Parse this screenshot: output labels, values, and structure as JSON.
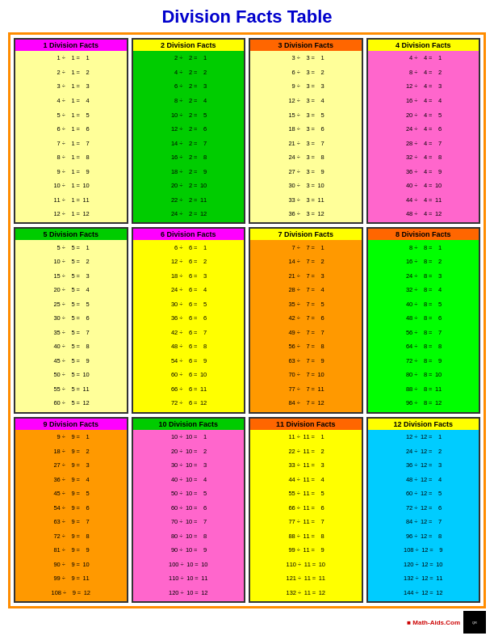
{
  "title": "Division Facts Table",
  "footer": {
    "site": "Math-Aids.Com"
  },
  "sections": [
    {
      "id": "s1",
      "title": "1 Division Facts",
      "divisor": 1,
      "facts": [
        [
          1,
          1,
          1
        ],
        [
          2,
          1,
          2
        ],
        [
          3,
          1,
          3
        ],
        [
          4,
          1,
          4
        ],
        [
          5,
          1,
          5
        ],
        [
          6,
          1,
          6
        ],
        [
          7,
          1,
          7
        ],
        [
          8,
          1,
          8
        ],
        [
          9,
          1,
          9
        ],
        [
          10,
          1,
          10
        ],
        [
          11,
          1,
          11
        ],
        [
          12,
          1,
          12
        ]
      ]
    },
    {
      "id": "s2",
      "title": "2 Division Facts",
      "divisor": 2,
      "facts": [
        [
          2,
          2,
          1
        ],
        [
          4,
          2,
          2
        ],
        [
          6,
          2,
          3
        ],
        [
          8,
          2,
          4
        ],
        [
          10,
          2,
          5
        ],
        [
          12,
          2,
          6
        ],
        [
          14,
          2,
          7
        ],
        [
          16,
          2,
          8
        ],
        [
          18,
          2,
          9
        ],
        [
          20,
          2,
          10
        ],
        [
          22,
          2,
          11
        ],
        [
          24,
          2,
          12
        ]
      ]
    },
    {
      "id": "s3",
      "title": "3 Division Facts",
      "divisor": 3,
      "facts": [
        [
          3,
          3,
          1
        ],
        [
          6,
          3,
          2
        ],
        [
          9,
          3,
          3
        ],
        [
          12,
          3,
          4
        ],
        [
          15,
          3,
          5
        ],
        [
          18,
          3,
          6
        ],
        [
          21,
          3,
          7
        ],
        [
          24,
          3,
          8
        ],
        [
          27,
          3,
          9
        ],
        [
          30,
          3,
          10
        ],
        [
          33,
          3,
          11
        ],
        [
          36,
          3,
          12
        ]
      ]
    },
    {
      "id": "s4",
      "title": "4 Division Facts",
      "divisor": 4,
      "facts": [
        [
          4,
          4,
          1
        ],
        [
          8,
          4,
          2
        ],
        [
          12,
          4,
          3
        ],
        [
          16,
          4,
          4
        ],
        [
          20,
          4,
          5
        ],
        [
          24,
          4,
          6
        ],
        [
          28,
          4,
          7
        ],
        [
          32,
          4,
          8
        ],
        [
          36,
          4,
          9
        ],
        [
          40,
          4,
          10
        ],
        [
          44,
          4,
          11
        ],
        [
          48,
          4,
          12
        ]
      ]
    },
    {
      "id": "s5",
      "title": "5 Division Facts",
      "divisor": 5,
      "facts": [
        [
          5,
          5,
          1
        ],
        [
          10,
          5,
          2
        ],
        [
          15,
          5,
          3
        ],
        [
          20,
          5,
          4
        ],
        [
          25,
          5,
          5
        ],
        [
          30,
          5,
          6
        ],
        [
          35,
          5,
          7
        ],
        [
          40,
          5,
          8
        ],
        [
          45,
          5,
          9
        ],
        [
          50,
          5,
          10
        ],
        [
          55,
          5,
          11
        ],
        [
          60,
          5,
          12
        ]
      ]
    },
    {
      "id": "s6",
      "title": "6 Division Facts",
      "divisor": 6,
      "facts": [
        [
          6,
          6,
          1
        ],
        [
          12,
          6,
          2
        ],
        [
          18,
          6,
          3
        ],
        [
          24,
          6,
          4
        ],
        [
          30,
          6,
          5
        ],
        [
          36,
          6,
          6
        ],
        [
          42,
          6,
          7
        ],
        [
          48,
          6,
          8
        ],
        [
          54,
          6,
          9
        ],
        [
          60,
          6,
          10
        ],
        [
          66,
          6,
          11
        ],
        [
          72,
          6,
          12
        ]
      ]
    },
    {
      "id": "s7",
      "title": "7 Division Facts",
      "divisor": 7,
      "facts": [
        [
          7,
          7,
          1
        ],
        [
          14,
          7,
          2
        ],
        [
          21,
          7,
          3
        ],
        [
          28,
          7,
          4
        ],
        [
          35,
          7,
          5
        ],
        [
          42,
          7,
          6
        ],
        [
          49,
          7,
          7
        ],
        [
          56,
          7,
          8
        ],
        [
          63,
          7,
          9
        ],
        [
          70,
          7,
          10
        ],
        [
          77,
          7,
          11
        ],
        [
          84,
          7,
          12
        ]
      ]
    },
    {
      "id": "s8",
      "title": "8 Division Facts",
      "divisor": 8,
      "facts": [
        [
          8,
          8,
          1
        ],
        [
          16,
          8,
          2
        ],
        [
          24,
          8,
          3
        ],
        [
          32,
          8,
          4
        ],
        [
          40,
          8,
          5
        ],
        [
          48,
          8,
          6
        ],
        [
          56,
          8,
          7
        ],
        [
          64,
          8,
          8
        ],
        [
          72,
          8,
          9
        ],
        [
          80,
          8,
          10
        ],
        [
          88,
          8,
          11
        ],
        [
          96,
          8,
          12
        ]
      ]
    },
    {
      "id": "s9",
      "title": "9 Division Facts",
      "divisor": 9,
      "facts": [
        [
          9,
          9,
          1
        ],
        [
          18,
          9,
          2
        ],
        [
          27,
          9,
          3
        ],
        [
          36,
          9,
          4
        ],
        [
          45,
          9,
          5
        ],
        [
          54,
          9,
          6
        ],
        [
          63,
          9,
          7
        ],
        [
          72,
          9,
          8
        ],
        [
          81,
          9,
          9
        ],
        [
          90,
          9,
          10
        ],
        [
          99,
          9,
          11
        ],
        [
          108,
          9,
          12
        ]
      ]
    },
    {
      "id": "s10",
      "title": "10 Division Facts",
      "divisor": 10,
      "facts": [
        [
          10,
          10,
          1
        ],
        [
          20,
          10,
          2
        ],
        [
          30,
          10,
          3
        ],
        [
          40,
          10,
          4
        ],
        [
          50,
          10,
          5
        ],
        [
          60,
          10,
          6
        ],
        [
          70,
          10,
          7
        ],
        [
          80,
          10,
          8
        ],
        [
          90,
          10,
          9
        ],
        [
          100,
          10,
          10
        ],
        [
          110,
          10,
          11
        ],
        [
          120,
          10,
          12
        ]
      ]
    },
    {
      "id": "s11",
      "title": "11 Division Facts",
      "divisor": 11,
      "facts": [
        [
          11,
          11,
          1
        ],
        [
          22,
          11,
          2
        ],
        [
          33,
          11,
          3
        ],
        [
          44,
          11,
          4
        ],
        [
          55,
          11,
          5
        ],
        [
          66,
          11,
          6
        ],
        [
          77,
          11,
          7
        ],
        [
          88,
          11,
          8
        ],
        [
          99,
          11,
          9
        ],
        [
          110,
          11,
          10
        ],
        [
          121,
          11,
          11
        ],
        [
          132,
          11,
          12
        ]
      ]
    },
    {
      "id": "s12",
      "title": "12 Division Facts",
      "divisor": 12,
      "facts": [
        [
          12,
          12,
          1
        ],
        [
          24,
          12,
          2
        ],
        [
          36,
          12,
          3
        ],
        [
          48,
          12,
          4
        ],
        [
          60,
          12,
          5
        ],
        [
          72,
          12,
          6
        ],
        [
          84,
          12,
          7
        ],
        [
          96,
          12,
          8
        ],
        [
          108,
          12,
          9
        ],
        [
          120,
          12,
          10
        ],
        [
          132,
          12,
          11
        ],
        [
          144,
          12,
          12
        ]
      ]
    }
  ]
}
